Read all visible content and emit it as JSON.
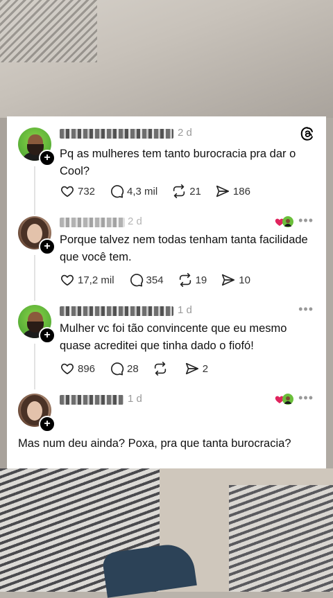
{
  "posts": [
    {
      "time": "2 d",
      "text": "Pq as mulheres tem tanto burocracia pra dar o Cool?",
      "likes": "732",
      "replies": "4,3 mil",
      "reposts": "21",
      "shares": "186"
    },
    {
      "time": "2 d",
      "text": "Porque talvez nem todas tenham tanta facilidade que você tem.",
      "likes": "17,2 mil",
      "replies": "354",
      "reposts": "19",
      "shares": "10"
    },
    {
      "time": "1 d",
      "text": "Mulher vc foi tão convincente que eu mesmo quase acreditei que tinha dado o fiofó!",
      "likes": "896",
      "replies": "28",
      "reposts": "",
      "shares": "2"
    },
    {
      "time": "1 d",
      "text": "Mas num deu ainda? Poxa, pra que tanta burocracia?"
    }
  ],
  "icons": {
    "like": "heart-icon",
    "reply": "comment-icon",
    "repost": "repost-icon",
    "share": "send-icon",
    "more": "more-icon",
    "follow": "plus-icon",
    "logo": "threads-logo-icon"
  },
  "more_label": "•••",
  "plus_label": "+"
}
